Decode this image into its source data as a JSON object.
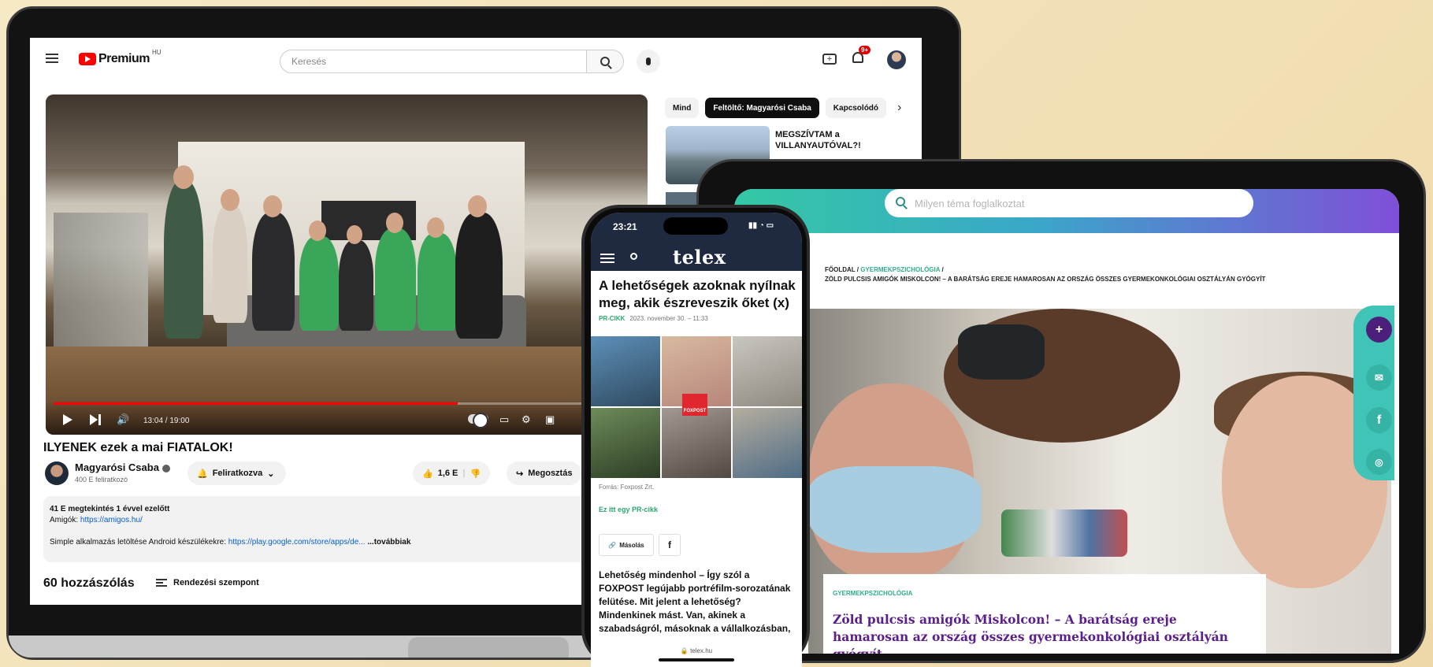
{
  "youtube": {
    "logo_text": "Premium",
    "region": "HU",
    "search_placeholder": "Keresés",
    "notifications_badge": "9+",
    "player": {
      "time": "13:04 / 19:00",
      "progress": 0.69
    },
    "video_title": "ILYENEK ezek a mai FIATALOK!",
    "channel_name": "Magyarósi Csaba",
    "subscribers": "400 E feliratkozó",
    "subscribe_label": "Feliratkozva",
    "likes": "1,6 E",
    "share_label": "Megosztás",
    "description": {
      "stats": "41 E megtekintés  1 évvel ezelőtt",
      "line1_prefix": "Amigók:",
      "line1_link": "https://amigos.hu/",
      "line2_prefix": "Simple alkalmazás letöltése Android készülékekre:",
      "line2_link": "https://play.google.com/store/apps/de...",
      "more": "...továbbiak"
    },
    "comments_count": "60 hozzászólás",
    "sort_label": "Rendezési szempont",
    "chips": [
      "Mind",
      "Feltöltő: Magyarósi Csaba",
      "Kapcsolódó"
    ],
    "recommendation_title": "MEGSZÍVTAM a VILLANYAUTÓVAL?!"
  },
  "tablet": {
    "search_placeholder": "Milyen téma foglalkoztat",
    "breadcrumb_home": "FŐOLDAL",
    "breadcrumb_category": "GYERMEKPSZICHOLÓGIA",
    "breadcrumb_current": "ZÖLD PULCSIS AMIGÓK MISKOLCON! – A BARÁTSÁG EREJE HAMAROSAN AZ ORSZÁG ÖSSZES GYERMEKONKOLÓGIAI OSZTÁLYÁN GYÓGYÍT",
    "card_category": "GYERMEKPSZICHOLÓGIA",
    "card_title": "Zöld pulcsis amigók Miskolcon! – A barátság ereje hamarosan az ország összes gyermekonkológiai osztályán gyógyít",
    "accent_purple": "#4b1f7a",
    "accent_teal": "#3fc4b7"
  },
  "phone": {
    "time": "23:21",
    "brand": "telex",
    "article_title": "A lehetőségek azoknak nyílnak meg, akik észreveszik őket (x)",
    "tag": "PR-CIKK",
    "date": "2023. november 30. – 11:33",
    "source": "Forrás: Foxpost Zrt.",
    "pr_link": "Ez itt egy PR-cikk",
    "copy_label": "Másolás",
    "fb_label": "f",
    "body": "Lehetőség mindenhol – Így szól a FOXPOST legújabb portréfilm-sorozatának felütése. Mit jelent a lehetőség? Mindenkinek mást. Van, akinek a szabadságról, másoknak a vállalkozásban,",
    "url": "telex.hu",
    "logo_overlay": "FOXPOST"
  }
}
